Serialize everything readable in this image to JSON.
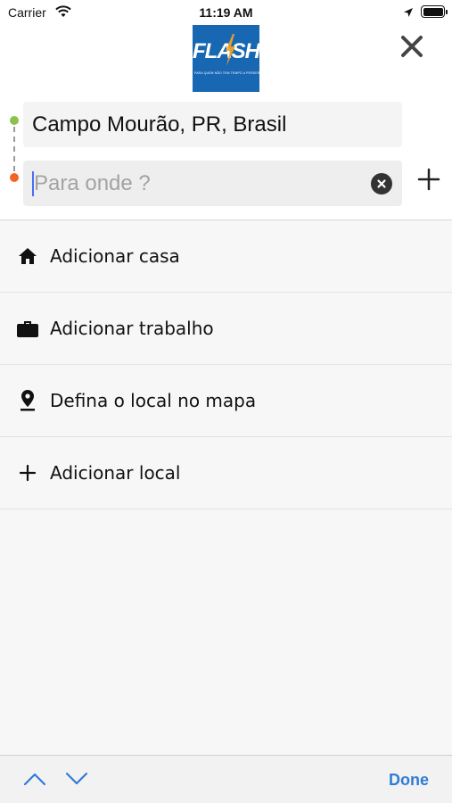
{
  "status_bar": {
    "carrier": "Carrier",
    "time": "11:19 AM",
    "icons": [
      "wifi-icon",
      "location-arrow-icon",
      "battery-icon"
    ]
  },
  "header": {
    "logo": {
      "name": "FLASH",
      "tagline": "PARA QUEM NÃO TEM TEMPO A PERDER",
      "color": "#1767b2"
    },
    "close_icon": "close-icon"
  },
  "route": {
    "origin": "Campo Mourão, PR, Brasil",
    "destination_value": "",
    "destination_placeholder": "Para onde ?",
    "origin_color": "#8bc34a",
    "destination_color": "#f26522"
  },
  "options": [
    {
      "icon": "home-icon",
      "label": "Adicionar casa"
    },
    {
      "icon": "briefcase-icon",
      "label": "Adicionar trabalho"
    },
    {
      "icon": "map-pin-icon",
      "label": "Defina o local no mapa"
    },
    {
      "icon": "plus-icon",
      "label": "Adicionar local"
    }
  ],
  "keyboard_bar": {
    "done_label": "Done",
    "accent": "#2f7cd6"
  }
}
